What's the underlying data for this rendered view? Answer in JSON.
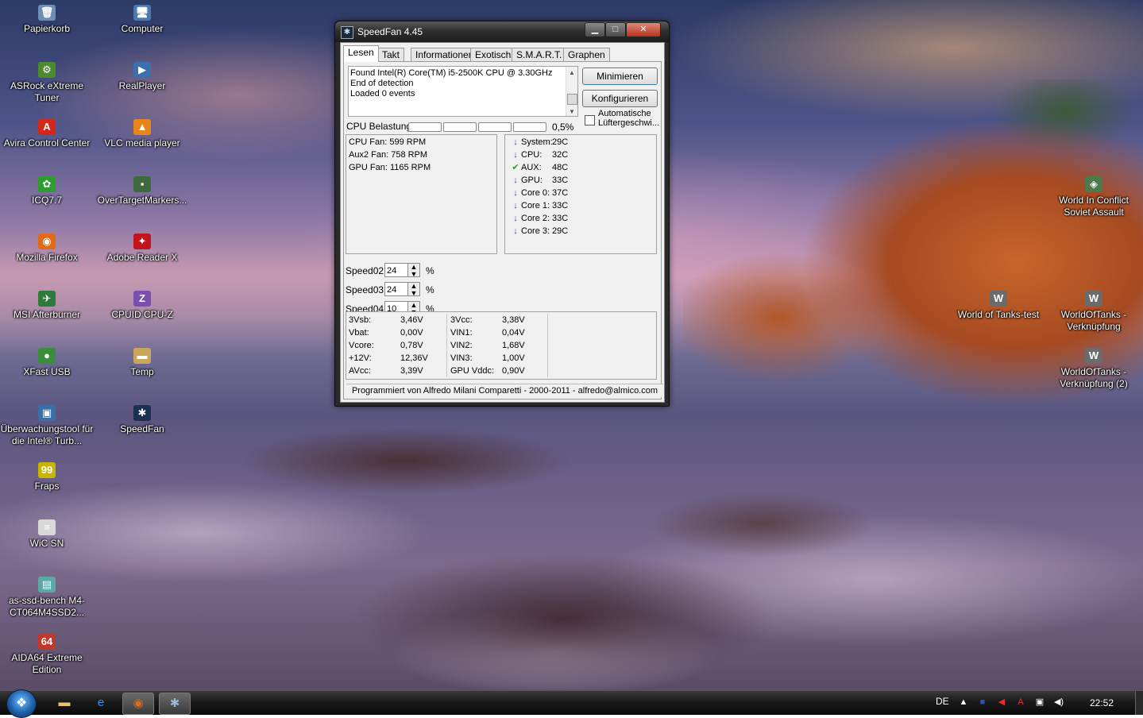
{
  "desktop": {
    "icons_left_col1": [
      {
        "label": "Papierkorb",
        "icon": "recycle-bin-icon",
        "glyph": "🗑",
        "color": "#6d8fb5"
      },
      {
        "label": "ASRock eXtreme Tuner",
        "icon": "asrock-tuner-icon",
        "glyph": "⚙",
        "color": "#4c8a2e"
      },
      {
        "label": "Avira Control Center",
        "icon": "avira-icon",
        "glyph": "A",
        "color": "#d4271b"
      },
      {
        "label": "ICQ7.7",
        "icon": "icq-icon",
        "glyph": "✿",
        "color": "#2e9c2e"
      },
      {
        "label": "Mozilla Firefox",
        "icon": "firefox-icon",
        "glyph": "◉",
        "color": "#e06a1a"
      },
      {
        "label": "MSI Afterburner",
        "icon": "msi-afterburner-icon",
        "glyph": "✈",
        "color": "#2f7a3a"
      },
      {
        "label": "XFast USB",
        "icon": "xfast-usb-icon",
        "glyph": "●",
        "color": "#3a8e3a"
      },
      {
        "label": "Überwachungstool für die Intel® Turb...",
        "icon": "intel-turbo-icon",
        "glyph": "▣",
        "color": "#3a6ea8"
      },
      {
        "label": "Fraps",
        "icon": "fraps-icon",
        "glyph": "99",
        "color": "#c9b400"
      },
      {
        "label": "WiC SN",
        "icon": "text-file-icon",
        "glyph": "≡",
        "color": "#d8d8d8"
      },
      {
        "label": "as-ssd-bench M4-CT064M4SSD2...",
        "icon": "image-file-icon",
        "glyph": "▤",
        "color": "#5aa8a8"
      },
      {
        "label": "AIDA64 Extreme Edition",
        "icon": "aida64-icon",
        "glyph": "64",
        "color": "#c0392b"
      }
    ],
    "icons_left_col2": [
      {
        "label": "Computer",
        "icon": "computer-icon",
        "glyph": "🖥",
        "color": "#4a78b0"
      },
      {
        "label": "RealPlayer",
        "icon": "realplayer-icon",
        "glyph": "▶",
        "color": "#3a6fb0"
      },
      {
        "label": "VLC media player",
        "icon": "vlc-icon",
        "glyph": "▲",
        "color": "#e8841a"
      },
      {
        "label": "OverTargetMarkers...",
        "icon": "program-icon",
        "glyph": "▪",
        "color": "#3c6a3c"
      },
      {
        "label": "Adobe Reader X",
        "icon": "adobe-reader-icon",
        "glyph": "✦",
        "color": "#c0161b"
      },
      {
        "label": "CPUID CPU-Z",
        "icon": "cpuz-icon",
        "glyph": "Z",
        "color": "#7a4fb0"
      },
      {
        "label": "Temp",
        "icon": "folder-icon",
        "glyph": "▬",
        "color": "#c9a65a"
      },
      {
        "label": "SpeedFan",
        "icon": "speedfan-icon",
        "glyph": "✱",
        "color": "#1c3050"
      }
    ],
    "icons_right": [
      {
        "label": "World In Conflict Soviet Assault",
        "icon": "world-in-conflict-icon",
        "glyph": "◈",
        "color": "#4c7a4c"
      },
      {
        "label": "World of Tanks-test",
        "icon": "wot-test-icon",
        "glyph": "W",
        "color": "#6b6b6b"
      },
      {
        "label": "WorldOfTanks - Verknüpfung",
        "icon": "wot-shortcut-icon",
        "glyph": "W",
        "color": "#6b6b6b"
      },
      {
        "label": "WorldOfTanks - Verknüpfung (2)",
        "icon": "wot-shortcut-2-icon",
        "glyph": "W",
        "color": "#6b6b6b"
      }
    ]
  },
  "window": {
    "title": "SpeedFan 4.45",
    "caption_min": "▁",
    "caption_max": "□",
    "caption_close": "✕",
    "tabs": [
      "Lesen",
      "Takt",
      "Informationen",
      "Exotisch",
      "S.M.A.R.T.",
      "Graphen"
    ],
    "active_tab": "Lesen",
    "log_lines": [
      "Found Intel(R) Core(TM) i5-2500K CPU @ 3.30GHz",
      "End of detection",
      "Loaded 0 events"
    ],
    "buttons": {
      "minimize": "Minimieren",
      "configure": "Konfigurieren"
    },
    "auto_fan": {
      "line1": "Automatische",
      "line2": "Lüftergeschwi...",
      "checked": false
    },
    "cpu_usage": {
      "label": "CPU Belastung",
      "value": "0,5%",
      "fraction": 0.005
    },
    "fans": [
      {
        "name": "CPU Fan:",
        "value": "599 RPM"
      },
      {
        "name": "Aux2 Fan:",
        "value": "758 RPM"
      },
      {
        "name": "GPU Fan:",
        "value": "1165 RPM"
      }
    ],
    "temps": [
      {
        "name": "System:",
        "value": "29C",
        "status": "down"
      },
      {
        "name": "CPU:",
        "value": "32C",
        "status": "down"
      },
      {
        "name": "AUX:",
        "value": "48C",
        "status": "ok"
      },
      {
        "name": "GPU:",
        "value": "33C",
        "status": "down"
      },
      {
        "name": "Core 0:",
        "value": "37C",
        "status": "down"
      },
      {
        "name": "Core 1:",
        "value": "33C",
        "status": "down"
      },
      {
        "name": "Core 2:",
        "value": "33C",
        "status": "down"
      },
      {
        "name": "Core 3:",
        "value": "29C",
        "status": "down"
      }
    ],
    "speeds": [
      {
        "label": "Speed02:",
        "value": "24",
        "unit": "%"
      },
      {
        "label": "Speed03:",
        "value": "24",
        "unit": "%"
      },
      {
        "label": "Speed04:",
        "value": "10",
        "unit": "%"
      }
    ],
    "voltages_left": [
      {
        "name": "3Vsb:",
        "value": "3,46V"
      },
      {
        "name": "Vbat:",
        "value": "0,00V"
      },
      {
        "name": "Vcore:",
        "value": "0,78V"
      },
      {
        "name": "+12V:",
        "value": "12,36V"
      },
      {
        "name": "AVcc:",
        "value": "3,39V"
      }
    ],
    "voltages_right": [
      {
        "name": "3Vcc:",
        "value": "3,38V"
      },
      {
        "name": "VIN1:",
        "value": "0,04V"
      },
      {
        "name": "VIN2:",
        "value": "1,68V"
      },
      {
        "name": "VIN3:",
        "value": "1,00V"
      },
      {
        "name": "GPU Vddc:",
        "value": "0,90V"
      }
    ],
    "status_bar": "Programmiert von Alfredo Milani Comparetti - 2000-2011 - alfredo@almico.com"
  },
  "taskbar": {
    "start_glyph": "❖",
    "pinned": [
      {
        "name": "explorer-icon",
        "glyph": "▬",
        "color": "#e3c46a",
        "open": false
      },
      {
        "name": "internet-explorer-icon",
        "glyph": "e",
        "color": "#3a8ee6",
        "open": false
      },
      {
        "name": "firefox-icon",
        "glyph": "◉",
        "color": "#e06a1a",
        "open": true
      },
      {
        "name": "speedfan-icon",
        "glyph": "✱",
        "color": "#9ab8d8",
        "open": true
      }
    ],
    "language": "DE",
    "tray": [
      {
        "name": "show-hidden-icon",
        "glyph": "▲",
        "color": "#ffffff"
      },
      {
        "name": "flag-icon",
        "glyph": "■",
        "color": "#3050c0"
      },
      {
        "name": "speaker-mute-icon",
        "glyph": "◀",
        "color": "#e03030"
      },
      {
        "name": "avira-tray-icon",
        "glyph": "A",
        "color": "#e03030"
      },
      {
        "name": "network-icon",
        "glyph": "▣",
        "color": "#ffffff"
      },
      {
        "name": "volume-icon",
        "glyph": "◀)",
        "color": "#ffffff"
      }
    ],
    "clock": "22:52"
  }
}
